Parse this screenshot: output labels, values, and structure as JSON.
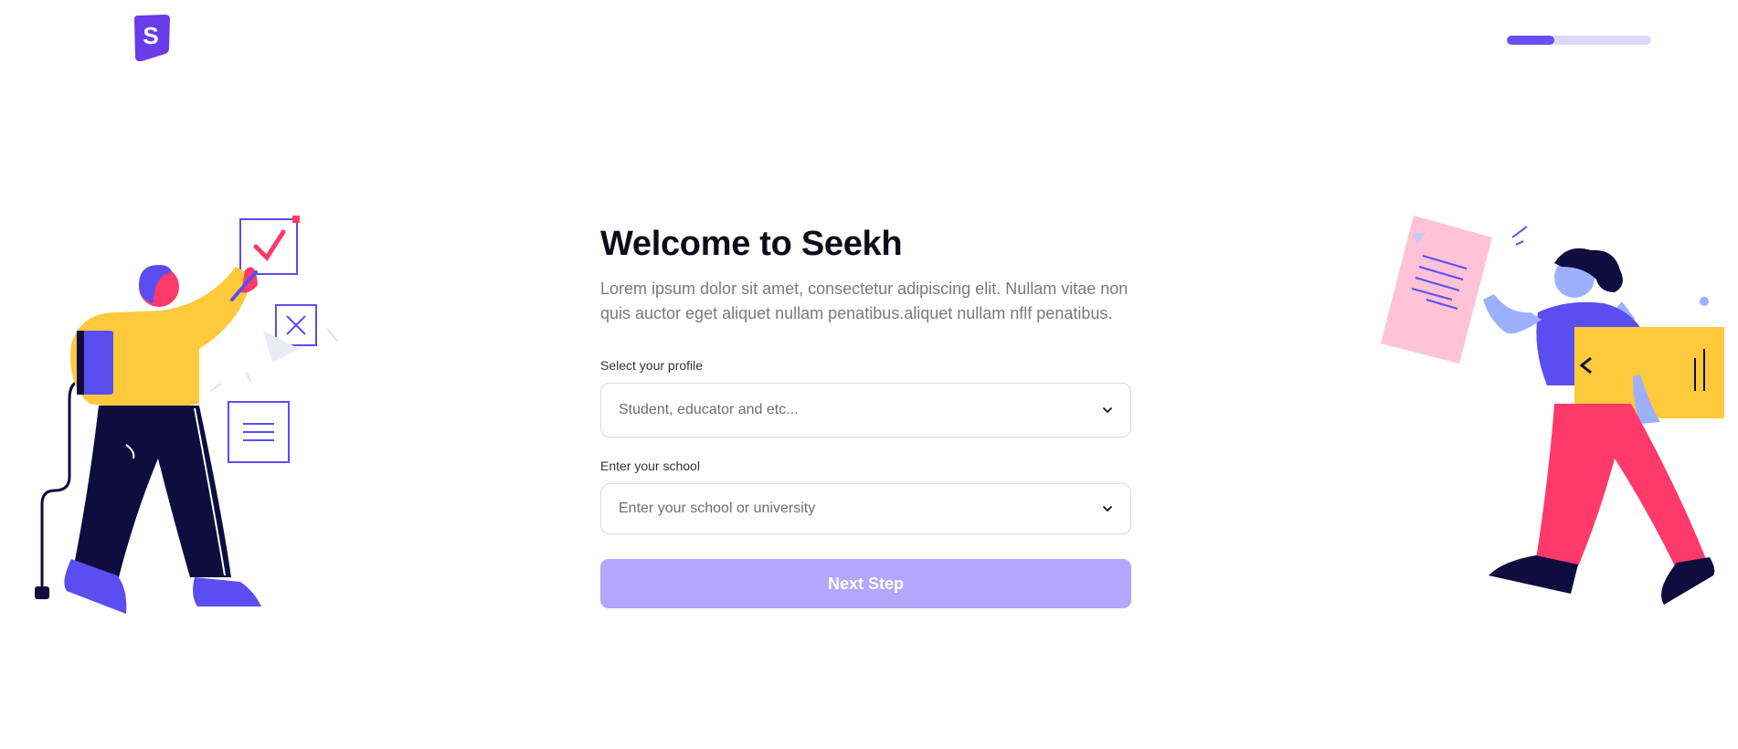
{
  "brand": {
    "logo_letter": "S",
    "logo_color": "#6a3de8"
  },
  "progress": {
    "fraction": 0.33,
    "fill_color": "#6a4ef0",
    "track_color": "#ded9fb"
  },
  "main": {
    "title": "Welcome to Seekh",
    "description": "Lorem ipsum dolor sit amet, consectetur adipiscing elit. Nullam vitae non quis auctor eget aliquet nullam penatibus.aliquet nullam nflf penatibus."
  },
  "form": {
    "profile_label": "Select your profile",
    "profile_placeholder": "Student, educator and etc...",
    "school_label": "Enter your school",
    "school_placeholder": "Enter your school or university",
    "next_label": "Next Step"
  },
  "colors": {
    "accent": "#6a4ef0",
    "button_disabled": "#b3a6fb",
    "pink": "#ff3a6a",
    "yellow": "#ffc93c",
    "navy": "#0f0c3e"
  }
}
